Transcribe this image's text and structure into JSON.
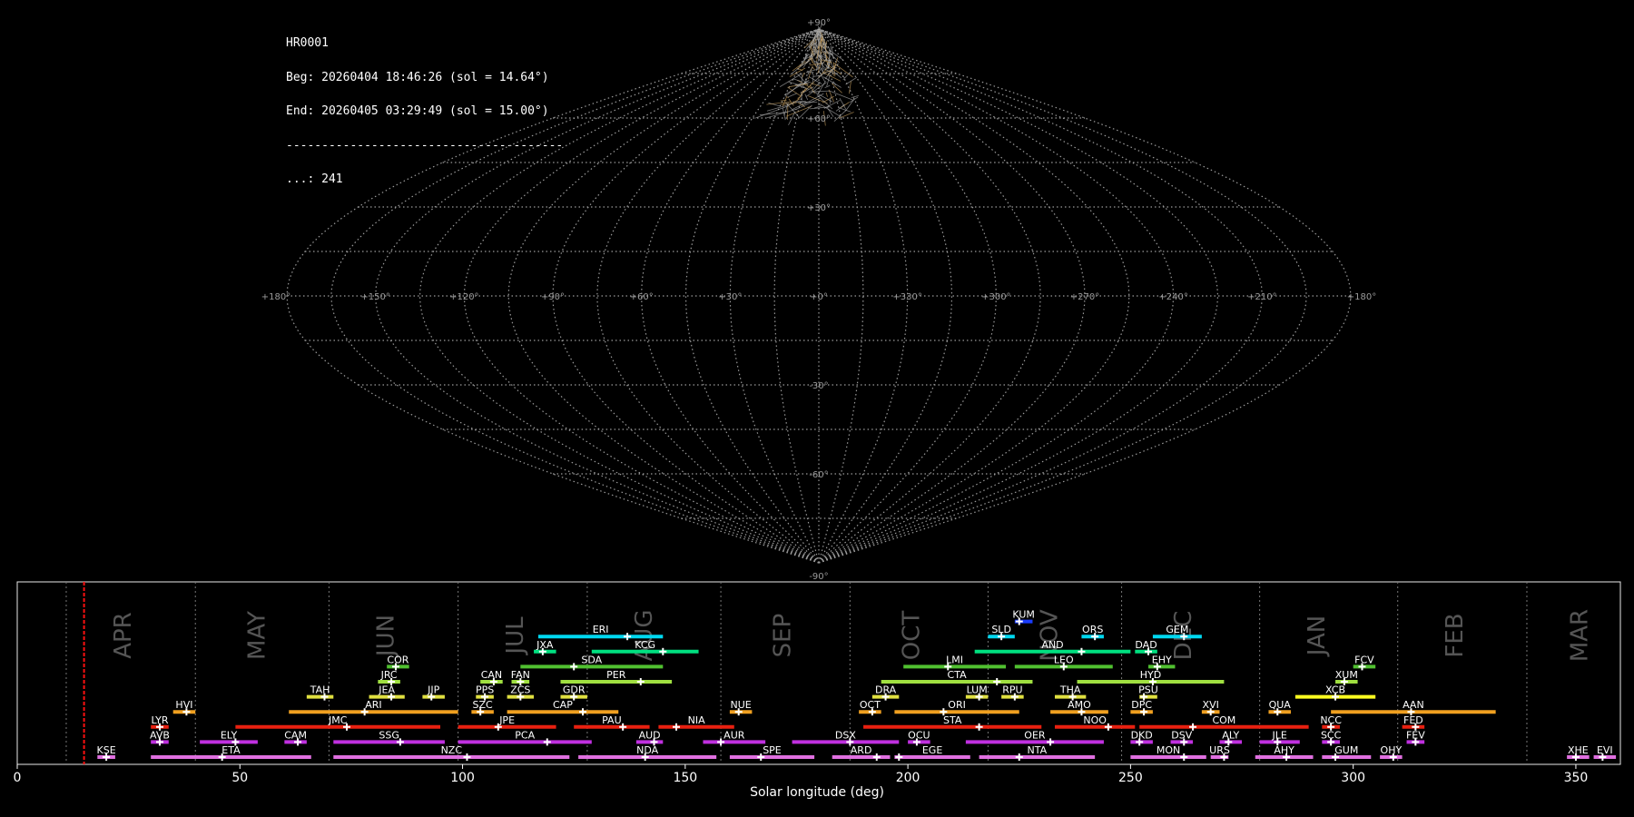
{
  "info": {
    "id": "HR0001",
    "beg": "Beg: 20260404 18:46:26 (sol = 14.64°)",
    "end": "End: 20260405 03:29:49 (sol = 15.00°)",
    "sep": "---------------------------------------",
    "count": "...: 241"
  },
  "sky_map": {
    "projection": "sinusoidal",
    "grid": true,
    "lat_labels": [
      "+90°",
      "+60°",
      "+30°",
      "-30°",
      "-60°",
      "-90°"
    ],
    "lon_labels": [
      "+180°",
      "+150°",
      "+120°",
      "+90°",
      "+60°",
      "+30°",
      "+0°",
      "+330°",
      "+300°",
      "+270°",
      "+240°",
      "+210°",
      "+180°"
    ],
    "meteor_count": 241
  },
  "chart_data": {
    "type": "range",
    "xlabel": "Solar longitude (deg)",
    "xlim": [
      0,
      360
    ],
    "xticks": [
      "0",
      "50",
      "100",
      "150",
      "200",
      "250",
      "300",
      "350"
    ],
    "current_sol": 15.0,
    "months": [
      {
        "name": "APR",
        "sol": 24
      },
      {
        "name": "MAY",
        "sol": 54
      },
      {
        "name": "JUN",
        "sol": 83
      },
      {
        "name": "JUL",
        "sol": 112
      },
      {
        "name": "AUG",
        "sol": 141
      },
      {
        "name": "SEP",
        "sol": 172
      },
      {
        "name": "OCT",
        "sol": 201
      },
      {
        "name": "NOV",
        "sol": 232
      },
      {
        "name": "DEC",
        "sol": 262
      },
      {
        "name": "JAN",
        "sol": 292
      },
      {
        "name": "FEB",
        "sol": 323
      },
      {
        "name": "MAR",
        "sol": 351
      }
    ],
    "month_boundaries": [
      11,
      40,
      70,
      99,
      128,
      158,
      187,
      218,
      248,
      279,
      310,
      339
    ],
    "showers": [
      {
        "code": "KUM",
        "row": 9,
        "start": 224,
        "end": 228,
        "peak": 225,
        "color": "#1a3cff"
      },
      {
        "code": "ERI",
        "row": 8,
        "start": 117,
        "end": 145,
        "peak": 137,
        "color": "#00d8f0"
      },
      {
        "code": "SLD",
        "row": 8,
        "start": 218,
        "end": 224,
        "peak": 221,
        "color": "#00d8f0"
      },
      {
        "code": "ORS",
        "row": 8,
        "start": 239,
        "end": 244,
        "peak": 242,
        "color": "#00d8f0"
      },
      {
        "code": "GEM",
        "row": 8,
        "start": 255,
        "end": 266,
        "peak": 262,
        "color": "#00d8f0"
      },
      {
        "code": "JXA",
        "row": 7,
        "start": 116,
        "end": 121,
        "peak": 118,
        "color": "#00e080"
      },
      {
        "code": "KCG",
        "row": 7,
        "start": 129,
        "end": 153,
        "peak": 145,
        "color": "#00e080"
      },
      {
        "code": "AND",
        "row": 7,
        "start": 215,
        "end": 250,
        "peak": 239,
        "color": "#00e080"
      },
      {
        "code": "DAD",
        "row": 7,
        "start": 251,
        "end": 256,
        "peak": 254,
        "color": "#00e080"
      },
      {
        "code": "COR",
        "row": 6,
        "start": 83,
        "end": 88,
        "peak": 85,
        "color": "#50c030"
      },
      {
        "code": "SDA",
        "row": 6,
        "start": 113,
        "end": 145,
        "peak": 125,
        "color": "#50c030"
      },
      {
        "code": "LMI",
        "row": 6,
        "start": 199,
        "end": 222,
        "peak": 209,
        "color": "#50c030"
      },
      {
        "code": "LEO",
        "row": 6,
        "start": 224,
        "end": 246,
        "peak": 235,
        "color": "#50c030"
      },
      {
        "code": "EHY",
        "row": 6,
        "start": 254,
        "end": 260,
        "peak": 256,
        "color": "#50c030"
      },
      {
        "code": "FCV",
        "row": 6,
        "start": 300,
        "end": 305,
        "peak": 302,
        "color": "#50c030"
      },
      {
        "code": "JRC",
        "row": 5,
        "start": 81,
        "end": 86,
        "peak": 84,
        "color": "#a0e040"
      },
      {
        "code": "CAN",
        "row": 5,
        "start": 104,
        "end": 109,
        "peak": 107,
        "color": "#a0e040"
      },
      {
        "code": "FAN",
        "row": 5,
        "start": 111,
        "end": 115,
        "peak": 113,
        "color": "#a0e040"
      },
      {
        "code": "PER",
        "row": 5,
        "start": 122,
        "end": 147,
        "peak": 140,
        "color": "#a0e040"
      },
      {
        "code": "CTA",
        "row": 5,
        "start": 194,
        "end": 228,
        "peak": 220,
        "color": "#a0e040"
      },
      {
        "code": "HYD",
        "row": 5,
        "start": 238,
        "end": 271,
        "peak": 255,
        "color": "#a0e040"
      },
      {
        "code": "XUM",
        "row": 5,
        "start": 296,
        "end": 301,
        "peak": 298,
        "color": "#a0e040"
      },
      {
        "code": "TAH",
        "row": 4,
        "start": 65,
        "end": 71,
        "peak": 69,
        "color": "#e0e040"
      },
      {
        "code": "JEA",
        "row": 4,
        "start": 79,
        "end": 87,
        "peak": 84,
        "color": "#e0e040"
      },
      {
        "code": "JIP",
        "row": 4,
        "start": 91,
        "end": 96,
        "peak": 93,
        "color": "#e0e040"
      },
      {
        "code": "PPS",
        "row": 4,
        "start": 103,
        "end": 107,
        "peak": 105,
        "color": "#e0e040"
      },
      {
        "code": "ZCS",
        "row": 4,
        "start": 110,
        "end": 116,
        "peak": 113,
        "color": "#e0e040"
      },
      {
        "code": "GDR",
        "row": 4,
        "start": 122,
        "end": 128,
        "peak": 125,
        "color": "#e0e040"
      },
      {
        "code": "DRA",
        "row": 4,
        "start": 192,
        "end": 198,
        "peak": 195,
        "color": "#e0e040"
      },
      {
        "code": "LUM",
        "row": 4,
        "start": 213,
        "end": 218,
        "peak": 216,
        "color": "#e0e040"
      },
      {
        "code": "RPU",
        "row": 4,
        "start": 221,
        "end": 226,
        "peak": 224,
        "color": "#e0e040"
      },
      {
        "code": "THA",
        "row": 4,
        "start": 233,
        "end": 240,
        "peak": 237,
        "color": "#e0e040"
      },
      {
        "code": "PSU",
        "row": 4,
        "start": 252,
        "end": 256,
        "peak": 253,
        "color": "#e0e040"
      },
      {
        "code": "XCB",
        "row": 4,
        "start": 287,
        "end": 305,
        "peak": 296,
        "color": "#ffff20"
      },
      {
        "code": "HVI",
        "row": 3,
        "start": 35,
        "end": 40,
        "peak": 38,
        "color": "#f0a020"
      },
      {
        "code": "ARI",
        "row": 3,
        "start": 61,
        "end": 99,
        "peak": 78,
        "color": "#f0a020"
      },
      {
        "code": "SZC",
        "row": 3,
        "start": 102,
        "end": 107,
        "peak": 104,
        "color": "#f0a020"
      },
      {
        "code": "CAP",
        "row": 3,
        "start": 110,
        "end": 135,
        "peak": 127,
        "color": "#f0a020"
      },
      {
        "code": "NUE",
        "row": 3,
        "start": 160,
        "end": 165,
        "peak": 162,
        "color": "#f0a020"
      },
      {
        "code": "OCT",
        "row": 3,
        "start": 189,
        "end": 194,
        "peak": 192,
        "color": "#f0a020"
      },
      {
        "code": "ORI",
        "row": 3,
        "start": 197,
        "end": 225,
        "peak": 208,
        "color": "#f0a020"
      },
      {
        "code": "AMO",
        "row": 3,
        "start": 232,
        "end": 245,
        "peak": 239,
        "color": "#f0a020"
      },
      {
        "code": "DPC",
        "row": 3,
        "start": 250,
        "end": 255,
        "peak": 253,
        "color": "#f0a020"
      },
      {
        "code": "XVI",
        "row": 3,
        "start": 266,
        "end": 270,
        "peak": 268,
        "color": "#f0a020"
      },
      {
        "code": "QUA",
        "row": 3,
        "start": 281,
        "end": 286,
        "peak": 283,
        "color": "#f0a020"
      },
      {
        "code": "AAN",
        "row": 3,
        "start": 295,
        "end": 332,
        "peak": 313,
        "color": "#f0a020"
      },
      {
        "code": "LYR",
        "row": 2,
        "start": 30,
        "end": 34,
        "peak": 32,
        "color": "#e82010"
      },
      {
        "code": "JMC",
        "row": 2,
        "start": 49,
        "end": 95,
        "peak": 74,
        "color": "#e82010"
      },
      {
        "code": "JPE",
        "row": 2,
        "start": 99,
        "end": 121,
        "peak": 108,
        "color": "#e82010"
      },
      {
        "code": "PAU",
        "row": 2,
        "start": 125,
        "end": 142,
        "peak": 136,
        "color": "#e82010"
      },
      {
        "code": "NIA",
        "row": 2,
        "start": 144,
        "end": 161,
        "peak": 148,
        "color": "#e82010"
      },
      {
        "code": "STA",
        "row": 2,
        "start": 190,
        "end": 230,
        "peak": 216,
        "color": "#e82010"
      },
      {
        "code": "NOO",
        "row": 2,
        "start": 233,
        "end": 251,
        "peak": 245,
        "color": "#e82010"
      },
      {
        "code": "COM",
        "row": 2,
        "start": 252,
        "end": 290,
        "peak": 264,
        "color": "#e82010"
      },
      {
        "code": "NCC",
        "row": 2,
        "start": 293,
        "end": 297,
        "peak": 295,
        "color": "#e82010"
      },
      {
        "code": "FED",
        "row": 2,
        "start": 311,
        "end": 316,
        "peak": 314,
        "color": "#e82010"
      },
      {
        "code": "AVB",
        "row": 1,
        "start": 30,
        "end": 34,
        "peak": 32,
        "color": "#c030e0"
      },
      {
        "code": "ELY",
        "row": 1,
        "start": 41,
        "end": 54,
        "peak": 49,
        "color": "#c030e0"
      },
      {
        "code": "CAM",
        "row": 1,
        "start": 60,
        "end": 65,
        "peak": 63,
        "color": "#c030e0"
      },
      {
        "code": "SSG",
        "row": 1,
        "start": 71,
        "end": 96,
        "peak": 86,
        "color": "#c030e0"
      },
      {
        "code": "PCA",
        "row": 1,
        "start": 99,
        "end": 129,
        "peak": 119,
        "color": "#c030e0"
      },
      {
        "code": "AUD",
        "row": 1,
        "start": 139,
        "end": 145,
        "peak": 143,
        "color": "#c030e0"
      },
      {
        "code": "AUR",
        "row": 1,
        "start": 154,
        "end": 168,
        "peak": 158,
        "color": "#c030e0"
      },
      {
        "code": "DSX",
        "row": 1,
        "start": 174,
        "end": 198,
        "peak": 187,
        "color": "#c030e0"
      },
      {
        "code": "OCU",
        "row": 1,
        "start": 200,
        "end": 205,
        "peak": 202,
        "color": "#c030e0"
      },
      {
        "code": "OER",
        "row": 1,
        "start": 213,
        "end": 244,
        "peak": 232,
        "color": "#c030e0"
      },
      {
        "code": "DKD",
        "row": 1,
        "start": 250,
        "end": 255,
        "peak": 252,
        "color": "#c030e0"
      },
      {
        "code": "DSV",
        "row": 1,
        "start": 259,
        "end": 264,
        "peak": 262,
        "color": "#c030e0"
      },
      {
        "code": "ALY",
        "row": 1,
        "start": 270,
        "end": 275,
        "peak": 272,
        "color": "#c030e0"
      },
      {
        "code": "JLE",
        "row": 1,
        "start": 279,
        "end": 288,
        "peak": 283,
        "color": "#c030e0"
      },
      {
        "code": "SCC",
        "row": 1,
        "start": 293,
        "end": 297,
        "peak": 295,
        "color": "#c030e0"
      },
      {
        "code": "FEV",
        "row": 1,
        "start": 312,
        "end": 316,
        "peak": 314,
        "color": "#c030e0"
      },
      {
        "code": "KSE",
        "row": 0,
        "start": 18,
        "end": 22,
        "peak": 20,
        "color": "#e070e0"
      },
      {
        "code": "ETA",
        "row": 0,
        "start": 30,
        "end": 66,
        "peak": 46,
        "color": "#e070e0"
      },
      {
        "code": "NZC",
        "row": 0,
        "start": 71,
        "end": 124,
        "peak": 101,
        "color": "#e070e0"
      },
      {
        "code": "NDA",
        "row": 0,
        "start": 126,
        "end": 157,
        "peak": 141,
        "color": "#e070e0"
      },
      {
        "code": "SPE",
        "row": 0,
        "start": 160,
        "end": 179,
        "peak": 167,
        "color": "#e070e0"
      },
      {
        "code": "ARD",
        "row": 0,
        "start": 183,
        "end": 196,
        "peak": 193,
        "color": "#e070e0"
      },
      {
        "code": "EGE",
        "row": 0,
        "start": 197,
        "end": 214,
        "peak": 198,
        "color": "#e070e0"
      },
      {
        "code": "NTA",
        "row": 0,
        "start": 216,
        "end": 242,
        "peak": 225,
        "color": "#e070e0"
      },
      {
        "code": "MON",
        "row": 0,
        "start": 250,
        "end": 267,
        "peak": 262,
        "color": "#e070e0"
      },
      {
        "code": "URS",
        "row": 0,
        "start": 268,
        "end": 272,
        "peak": 271,
        "color": "#e070e0"
      },
      {
        "code": "AHY",
        "row": 0,
        "start": 278,
        "end": 291,
        "peak": 285,
        "color": "#e070e0"
      },
      {
        "code": "GUM",
        "row": 0,
        "start": 293,
        "end": 304,
        "peak": 296,
        "color": "#e070e0"
      },
      {
        "code": "OHY",
        "row": 0,
        "start": 306,
        "end": 311,
        "peak": 309,
        "color": "#e070e0"
      },
      {
        "code": "XHE",
        "row": 0,
        "start": 348,
        "end": 353,
        "peak": 350,
        "color": "#e070e0"
      },
      {
        "code": "EVI",
        "row": 0,
        "start": 354,
        "end": 359,
        "peak": 356,
        "color": "#e070e0"
      }
    ]
  }
}
